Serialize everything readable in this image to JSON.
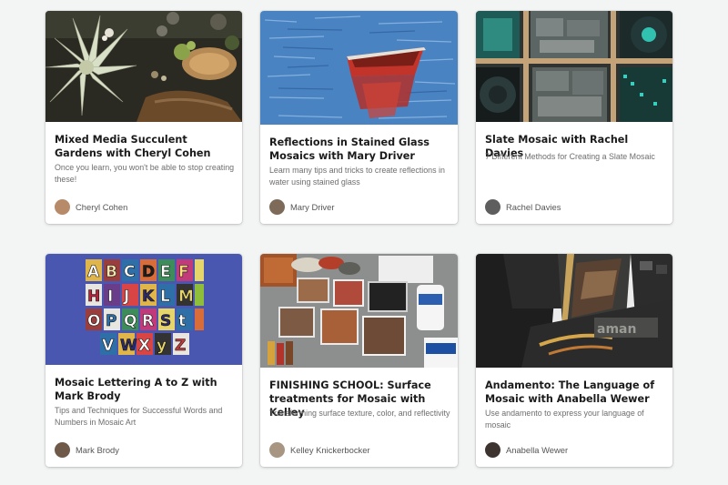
{
  "courses": [
    {
      "title": "Mixed Media Succulent Gardens with Cheryl Cohen",
      "description": "Once you learn, you won't be able to stop creating these!",
      "instructor": "Cheryl Cohen",
      "thumbnail_icon": "succulent-garden-image"
    },
    {
      "title": "Reflections in Stained Glass Mosaics with Mary Driver",
      "description": "Learn many tips and tricks to create reflections in water using stained glass",
      "instructor": "Mary Driver",
      "thumbnail_icon": "boat-reflection-image"
    },
    {
      "title": "Slate Mosaic with Rachel Davies",
      "description": "7 Different Methods for Creating a Slate Mosaic",
      "instructor": "Rachel Davies",
      "thumbnail_icon": "slate-mosaic-image"
    },
    {
      "title": "Mosaic Lettering A to Z with Mark Brody",
      "description": "Tips and Techniques for Successful Words and Numbers in Mosaic Art",
      "instructor": "Mark Brody",
      "thumbnail_icon": "mosaic-alphabet-image"
    },
    {
      "title": "FINISHING SCHOOL: Surface treatments for Mosaic with Kelley",
      "description": "Transforming surface texture, color, and reflectivity",
      "instructor": "Kelley Knickerbocker",
      "thumbnail_icon": "surface-treatments-image"
    },
    {
      "title": "Andamento: The Language of Mosaic with Anabella Wewer",
      "description": "Use andamento to express your language of mosaic",
      "instructor": "Anabella Wewer",
      "thumbnail_icon": "andamento-image"
    }
  ],
  "colors": {
    "page_background": "#f3f4f4",
    "card_background": "#ffffff",
    "title_text": "#1b1b1b",
    "description_text": "#6e6e6e"
  }
}
